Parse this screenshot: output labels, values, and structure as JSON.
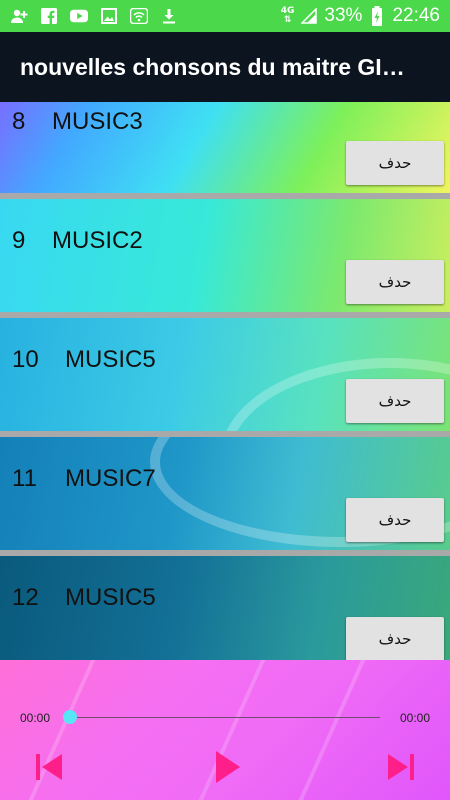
{
  "status_bar": {
    "icons": [
      "add-contact-icon",
      "facebook-icon",
      "youtube-icon",
      "gallery-icon",
      "wifi-icon",
      "download-icon"
    ],
    "network": "4G",
    "battery": "33%",
    "time": "22:46"
  },
  "app_bar": {
    "title": "nouvelles chonsons du maitre GI…"
  },
  "songs": [
    {
      "number": "8",
      "name": "MUSIC3",
      "delete_label": "حدف"
    },
    {
      "number": "9",
      "name": "MUSIC2",
      "delete_label": "حدف"
    },
    {
      "number": "10",
      "name": "MUSIC5",
      "delete_label": "حدف"
    },
    {
      "number": "11",
      "name": "MUSIC7",
      "delete_label": "حدف"
    },
    {
      "number": "12",
      "name": "MUSIC5",
      "delete_label": "حدف"
    }
  ],
  "player": {
    "current_time": "00:00",
    "total_time": "00:00",
    "progress": 0,
    "accent_color": "#ff1f8a",
    "thumb_color": "#56e6f5"
  }
}
